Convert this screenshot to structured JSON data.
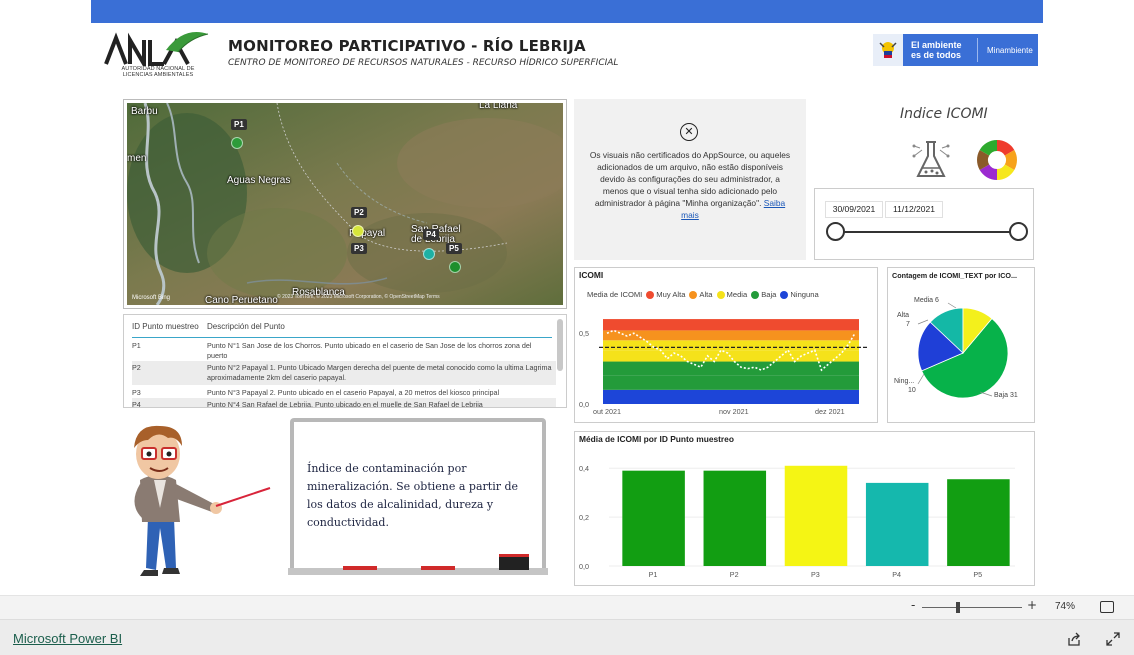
{
  "header": {
    "logo_word": "ANLA",
    "logo_caption": "AUTORIDAD NACIONAL DE LICENCIAS AMBIENTALES",
    "title": "MONITOREO PARTICIPATIVO - RÍO LEBRIJA",
    "subtitle": "CENTRO DE MONITOREO DE RECURSOS NATURALES - RECURSO HÍDRICO SUPERFICIAL",
    "gov_slogan_line1": "El ambiente",
    "gov_slogan_line2": "es de todos",
    "gov_ministry": "Minambiente",
    "colors": {
      "topbar": "#3a6fd6"
    }
  },
  "map": {
    "places": [
      "Barbu",
      "La Llana",
      "men",
      "Aguas Negras",
      "Papayal",
      "San Rafael de Lebrija",
      "Cano Peruetano",
      "Rosablanca"
    ],
    "pins": [
      {
        "label": "P1",
        "color": "#2e9b3a"
      },
      {
        "label": "P2",
        "color": "#d7e63a"
      },
      {
        "label": "P3",
        "color": "#d7e63a"
      },
      {
        "label": "P4",
        "color": "#1db1a4"
      },
      {
        "label": "P5",
        "color": "#1e8f2c"
      }
    ],
    "attribution_logo": "Microsoft Bing",
    "copyright": "© 2023 TomTom, © 2023 Microsoft Corporation, © OpenStreetMap Terms"
  },
  "table": {
    "columns": [
      "ID Punto muestreo",
      "Descripción del Punto"
    ],
    "rows": [
      [
        "P1",
        "Punto N°1 San Jose de los Chorros. Punto ubicado en el caserio de San Jose de los chorros zona del puerto"
      ],
      [
        "P2",
        "Punto N°2 Papayal 1. Punto Ubicado Margen derecha del puente de metal conocido como la ultima Lagrima aproximadamente 2km del caserio papayal."
      ],
      [
        "P3",
        "Punto N°3 Papayal 2. Punto ubicado en el caserio Papayal, a 20 metros del kiosco principal"
      ],
      [
        "P4",
        "Punto N°4 San Rafael de Lebrija. Punto ubicado en el muelle de San Rafael de Lebrija"
      ]
    ]
  },
  "message": {
    "icon": "close-circle-icon",
    "text": "Os visuais não certificados do AppSource, ou aqueles adicionados de um arquivo, não estão disponíveis devido às configurações do seu administrador, a menos que o visual tenha sido adicionado pelo administrador à página \"Minha organização\".",
    "link": "Saiba mais"
  },
  "icomi_panel": {
    "title": "Indice ICOMI",
    "icons": [
      "flask-icon",
      "color-ring-icon"
    ]
  },
  "date_slicer": {
    "start": "30/09/2021",
    "end": "11/12/2021",
    "range_fraction": [
      0,
      1
    ]
  },
  "line_chart": {
    "title": "ICOMI",
    "legend_label": "Media de ICOMI",
    "legend": [
      {
        "name": "Muy Alta",
        "color": "#ef4b2f"
      },
      {
        "name": "Alta",
        "color": "#f6921e"
      },
      {
        "name": "Media",
        "color": "#f5e21a"
      },
      {
        "name": "Baja",
        "color": "#239b3a"
      },
      {
        "name": "Ninguna",
        "color": "#1d45d8"
      }
    ]
  },
  "donut_chart": {
    "title": "Contagem de ICOMI_TEXT por ICO...",
    "labels": [
      "Media 6",
      "Alta",
      "7",
      "Ning...",
      "10",
      "Baja 31"
    ]
  },
  "bar_chart": {
    "title": "Média de ICOMI por ID Punto muestreo"
  },
  "chart_data": [
    {
      "type": "line",
      "title": "ICOMI",
      "x_ticks": [
        "out 2021",
        "nov 2021",
        "dez 2021"
      ],
      "y_ticks": [
        "0,0",
        "0,5"
      ],
      "ylim": [
        0,
        0.65
      ],
      "bands": [
        {
          "name": "Ninguna",
          "from": 0.0,
          "to": 0.1,
          "color": "#1d45d8"
        },
        {
          "name": "Baja",
          "from": 0.1,
          "to": 0.2,
          "color": "#239b3a"
        },
        {
          "name": "Media",
          "from": 0.2,
          "to": 0.3,
          "color": "#239b3a"
        },
        {
          "name": "Media",
          "from": 0.3,
          "to": 0.38,
          "color": "#f5e21a"
        },
        {
          "name": "Media",
          "from": 0.38,
          "to": 0.45,
          "color": "#f5e21a"
        },
        {
          "name": "Alta",
          "from": 0.45,
          "to": 0.52,
          "color": "#f6921e"
        },
        {
          "name": "Muy Alta",
          "from": 0.52,
          "to": 0.6,
          "color": "#ef4b2f"
        }
      ],
      "average_line": 0.4,
      "series": [
        {
          "values": [
            0.5,
            0.52,
            0.5,
            0.48,
            0.5,
            0.47,
            0.44,
            0.4,
            0.38,
            0.32,
            0.36,
            0.34,
            0.3,
            0.28,
            0.26,
            0.34,
            0.3,
            0.38,
            0.36,
            0.3,
            0.26,
            0.25,
            0.26,
            0.24,
            0.26,
            0.3,
            0.34,
            0.38,
            0.3,
            0.34,
            0.36,
            0.38,
            0.24,
            0.28,
            0.32,
            0.36,
            0.42,
            0.5
          ]
        }
      ]
    },
    {
      "type": "pie",
      "title": "Contagem de ICOMI_TEXT por ICO...",
      "slices": [
        {
          "name": "Baja",
          "value": 31,
          "color": "#07b24a"
        },
        {
          "name": "Ninguna",
          "value": 10,
          "color": "#1f3fd7"
        },
        {
          "name": "Alta",
          "value": 7,
          "color": "#14b8a6"
        },
        {
          "name": "Media",
          "value": 6,
          "color": "#f3f01c"
        }
      ]
    },
    {
      "type": "bar",
      "title": "Média de ICOMI por ID Punto muestreo",
      "categories": [
        "P1",
        "P2",
        "P3",
        "P4",
        "P5"
      ],
      "values": [
        0.39,
        0.39,
        0.41,
        0.34,
        0.355
      ],
      "colors": [
        "#129e12",
        "#129e12",
        "#f5f514",
        "#15b8ad",
        "#129e12"
      ],
      "y_ticks": [
        "0,0",
        "0,2",
        "0,4"
      ],
      "ylim": [
        0,
        0.45
      ]
    }
  ],
  "whiteboard": {
    "text": "Índice de contaminación por mineralización. Se obtiene a partir de los datos de alcalinidad, dureza y conductividad."
  },
  "footer": {
    "zoom": "74%",
    "zoom_fraction": 0.36,
    "brand_link": "Microsoft Power BI"
  }
}
